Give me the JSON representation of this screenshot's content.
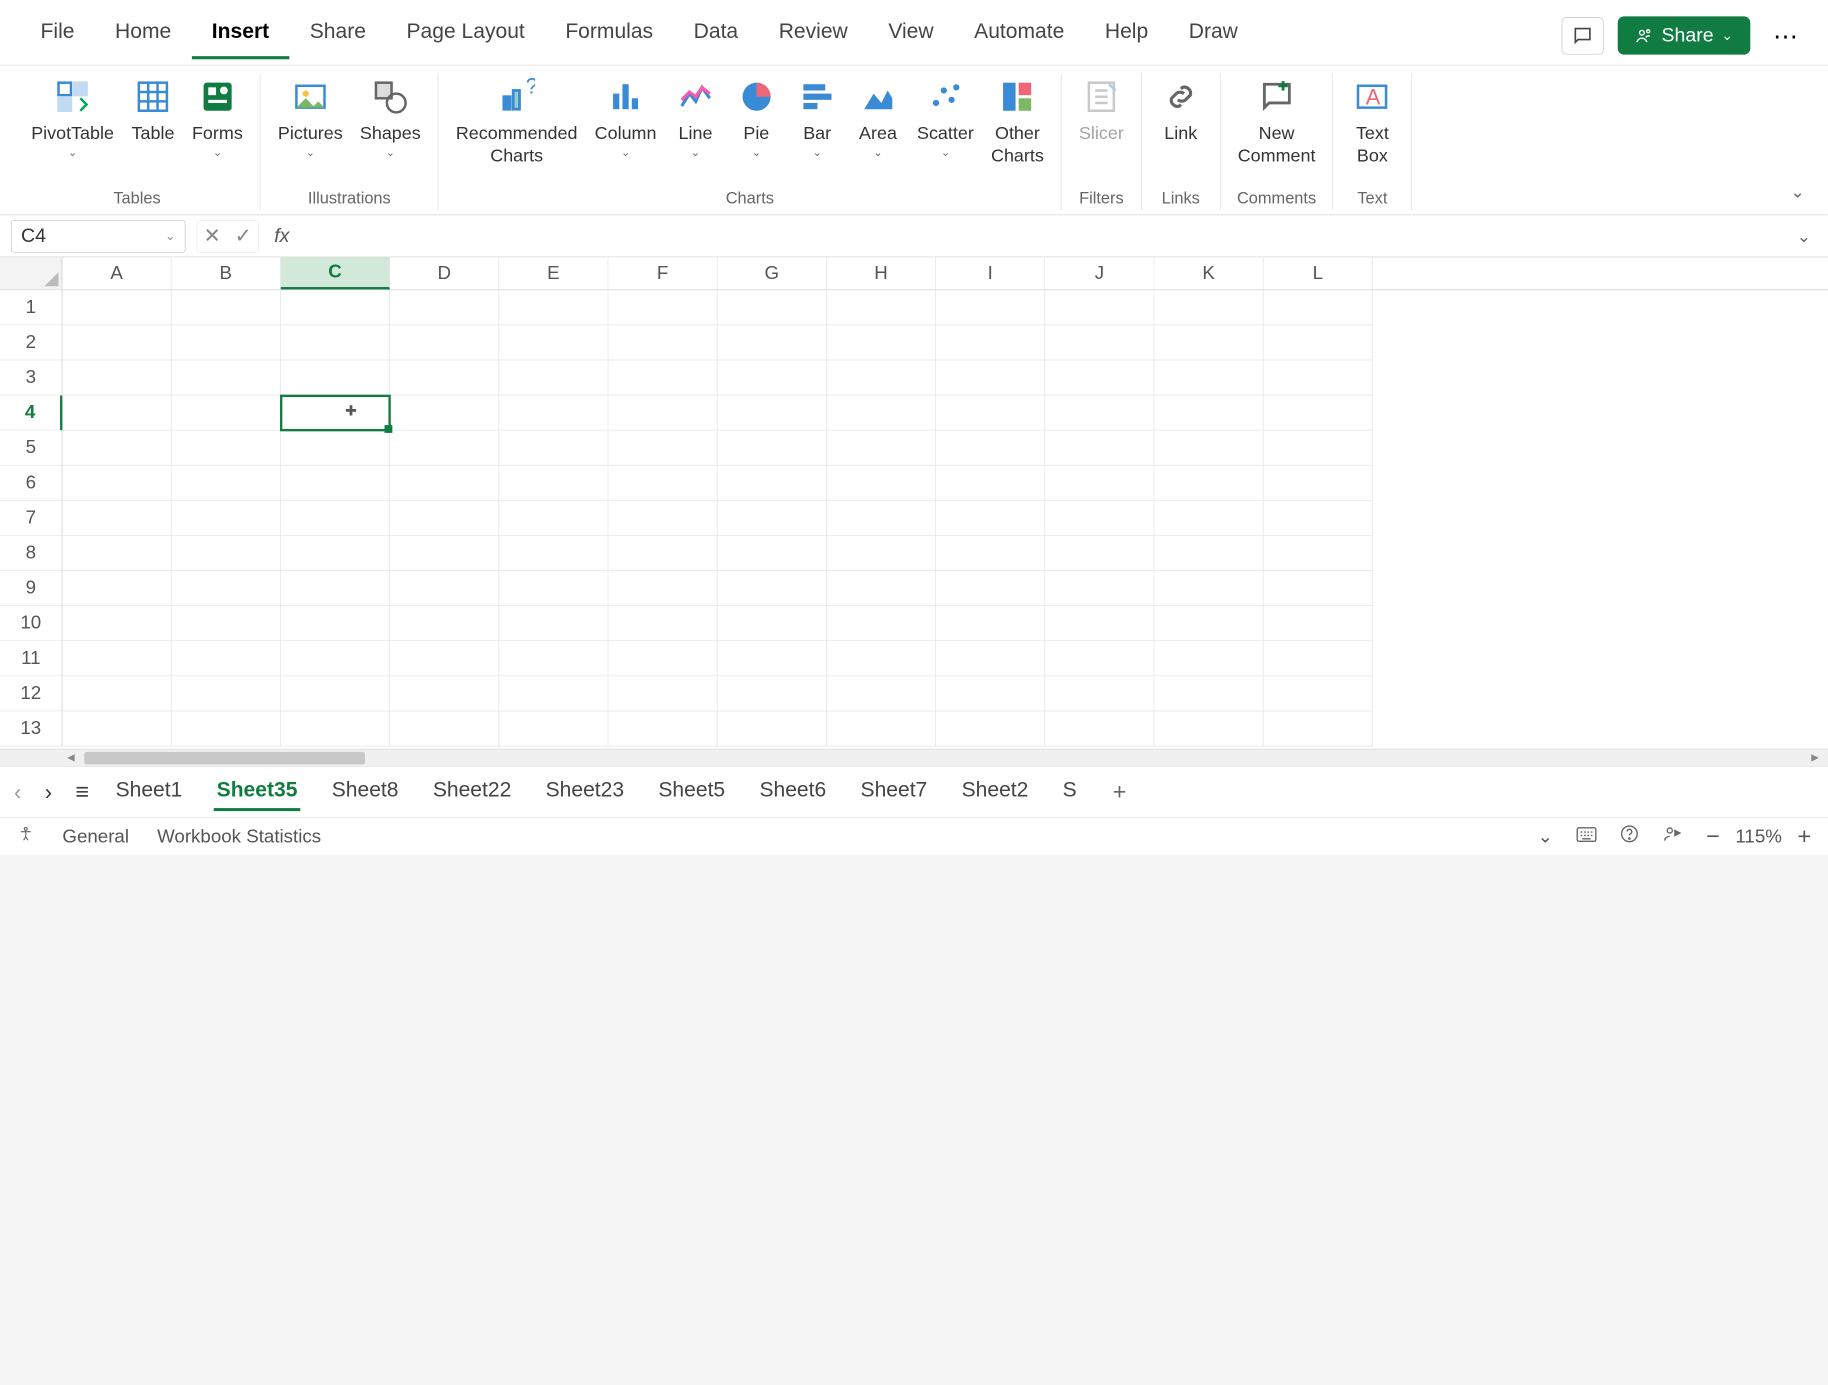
{
  "tabs": {
    "file": "File",
    "home": "Home",
    "insert": "Insert",
    "share": "Share",
    "pageLayout": "Page Layout",
    "formulas": "Formulas",
    "data": "Data",
    "review": "Review",
    "view": "View",
    "automate": "Automate",
    "help": "Help",
    "draw": "Draw",
    "active": "Insert"
  },
  "topRight": {
    "share": "Share"
  },
  "ribbon": {
    "tables": {
      "pivot": "PivotTable",
      "table": "Table",
      "forms": "Forms",
      "group": "Tables"
    },
    "illus": {
      "pictures": "Pictures",
      "shapes": "Shapes",
      "group": "Illustrations"
    },
    "charts": {
      "rec": "Recommended\nCharts",
      "column": "Column",
      "line": "Line",
      "pie": "Pie",
      "bar": "Bar",
      "area": "Area",
      "scatter": "Scatter",
      "other": "Other\nCharts",
      "group": "Charts"
    },
    "filters": {
      "slicer": "Slicer",
      "group": "Filters"
    },
    "links": {
      "link": "Link",
      "group": "Links"
    },
    "comments": {
      "new": "New\nComment",
      "group": "Comments"
    },
    "text": {
      "box": "Text\nBox",
      "group": "Text"
    }
  },
  "formulaBar": {
    "nameBox": "C4",
    "formula": ""
  },
  "grid": {
    "columns": [
      "A",
      "B",
      "C",
      "D",
      "E",
      "F",
      "G",
      "H",
      "I",
      "J",
      "K",
      "L"
    ],
    "rows": [
      "1",
      "2",
      "3",
      "4",
      "5",
      "6",
      "7",
      "8",
      "9",
      "10",
      "11",
      "12",
      "13"
    ],
    "selectedCol": "C",
    "selectedRow": "4"
  },
  "sheets": {
    "tabs": [
      "Sheet1",
      "Sheet35",
      "Sheet8",
      "Sheet22",
      "Sheet23",
      "Sheet5",
      "Sheet6",
      "Sheet7",
      "Sheet2",
      "S"
    ],
    "active": "Sheet35"
  },
  "status": {
    "mode": "General",
    "stats": "Workbook Statistics",
    "zoom": "115%"
  }
}
